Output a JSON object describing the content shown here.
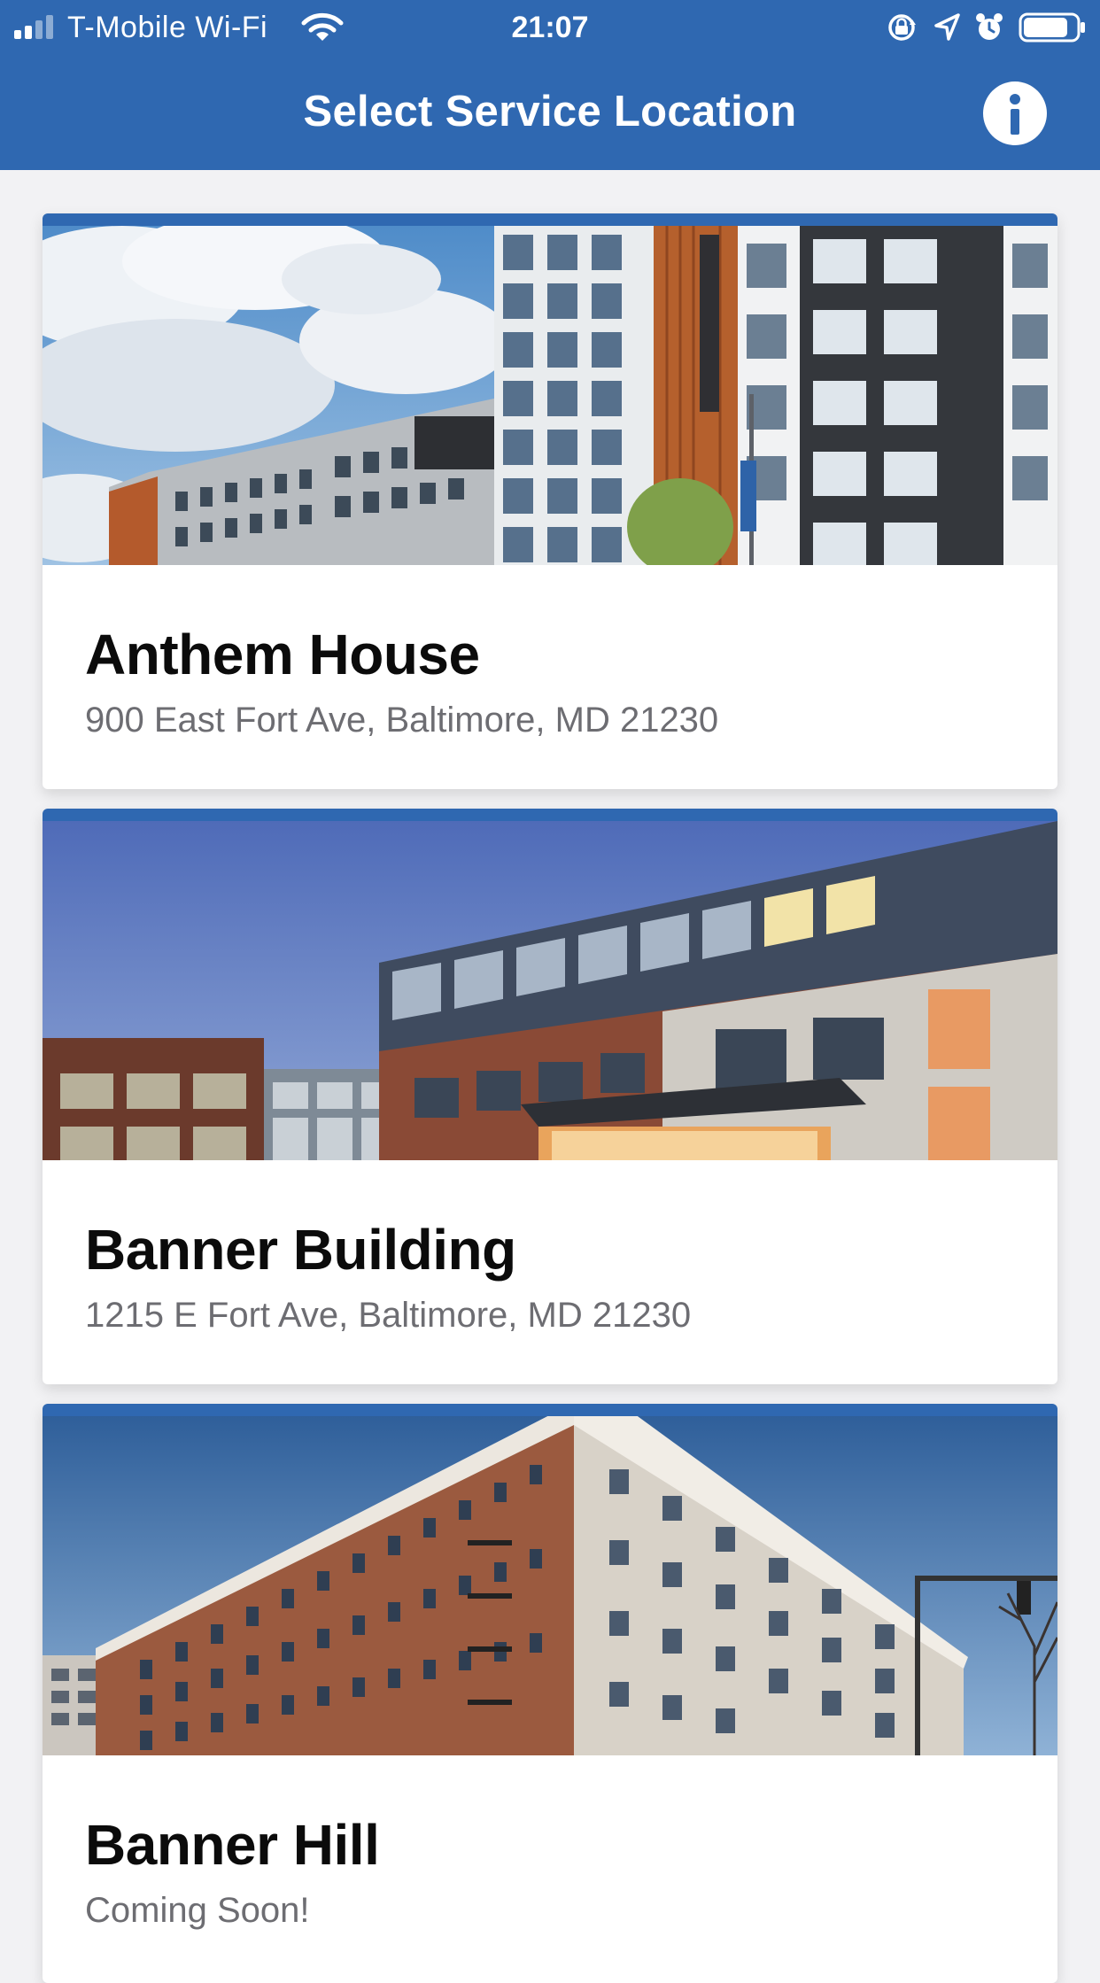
{
  "status_bar": {
    "carrier": "T-Mobile Wi-Fi",
    "time": "21:07",
    "signal_icon": "cellular-signal-icon",
    "wifi_icon": "wifi-icon",
    "orientation_lock_icon": "orientation-lock-icon",
    "location_icon": "location-arrow-icon",
    "alarm_icon": "alarm-clock-icon",
    "battery_icon": "battery-icon",
    "battery_level": 0.85
  },
  "navigation": {
    "title": "Select Service Location",
    "info_icon": "info-icon"
  },
  "colors": {
    "primary": "#2f68b1",
    "background": "#f2f2f4",
    "card": "#ffffff",
    "title_text": "#0b0b0b",
    "subtitle_text": "#6d6d72"
  },
  "locations": [
    {
      "name": "Anthem House",
      "address": "900 East Fort Ave, Baltimore, MD 21230",
      "photo": "anthem-house-photo"
    },
    {
      "name": "Banner Building",
      "address": "1215 E Fort Ave, Baltimore, MD 21230",
      "photo": "banner-building-photo"
    },
    {
      "name": "Banner Hill",
      "address": "Coming Soon!",
      "photo": "banner-hill-photo"
    }
  ]
}
